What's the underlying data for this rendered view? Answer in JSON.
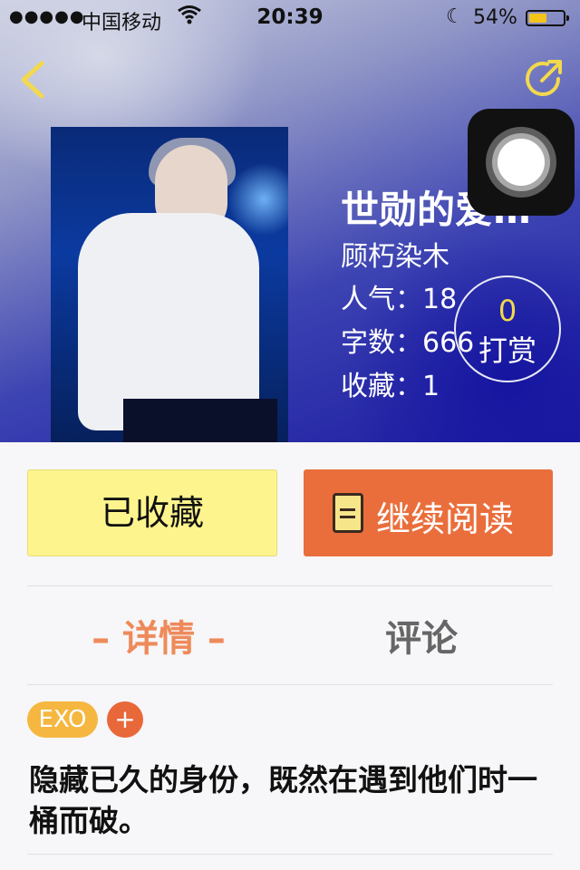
{
  "status_bar": {
    "signal": "●●●●●",
    "carrier": "中国移动",
    "time": "20:39",
    "battery_percent": "54%",
    "battery_level": 0.54
  },
  "book": {
    "title": "世勋的爱…",
    "author": "顾朽染木",
    "popularity": "人气：18",
    "word_count": "字数：666",
    "favorites": "收藏：1"
  },
  "tip": {
    "count": "0",
    "label": "打赏"
  },
  "actions": {
    "favorited_label": "已收藏",
    "continue_label": "继续阅读"
  },
  "tabs": {
    "detail": "– 详情 –",
    "comment": "评论"
  },
  "tags": [
    "EXO"
  ],
  "tag_add": "+",
  "description": "隐藏已久的身份，既然在遇到他们时一桶而破。",
  "colors": {
    "fav_button_bg": "#fef48e",
    "read_button_bg": "#ea6e3b",
    "active_tab": "#ee8a5a",
    "tag_bg": "#f5b740",
    "accent_yellow": "#f2d94e"
  }
}
